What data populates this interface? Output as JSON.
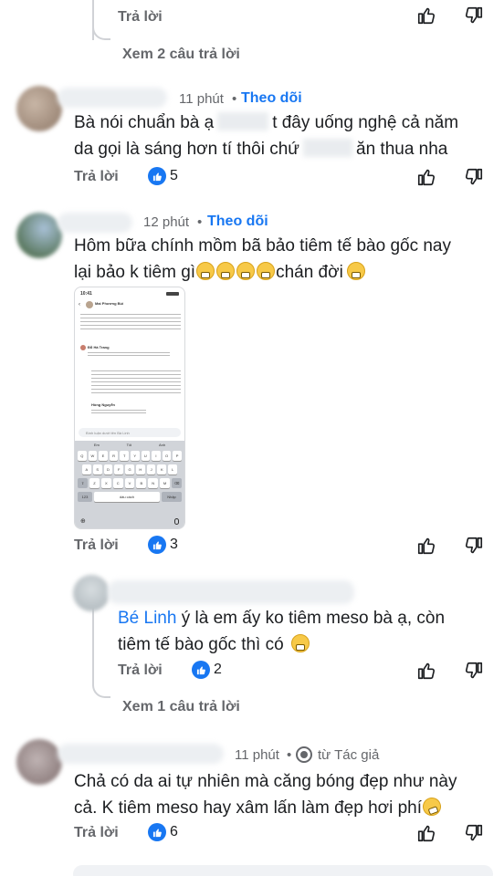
{
  "actions": {
    "reply": "Trả lời"
  },
  "top_reply": {
    "view_more": "Xem 2 câu trả lời"
  },
  "comment1": {
    "time": "11 phút",
    "separator": "•",
    "follow": "Theo dõi",
    "line1_a": "Bà nói chuẩn bà ạ",
    "line1_b": "t đây uống nghệ cả năm",
    "line2_a": "da gọi là sáng hơn tí thôi chứ",
    "line2_b": "ăn thua nha",
    "reactions": "5"
  },
  "comment2": {
    "time": "12 phút",
    "separator": "•",
    "follow": "Theo dõi",
    "line1": "Hôm bữa chính mồm bã bảo tiêm tế bào gốc nay",
    "line2_a": "lại bảo k tiêm gì",
    "line2_b": "chán đời",
    "reactions": "3"
  },
  "screenshot": {
    "time": "10:41",
    "author": "Mai Phương Bùi",
    "commenter1": "Đỗ Hà Trang",
    "commenter2": "Hồng Nguyễn",
    "input_placeholder": "Bình luận dưới tên Bà Linh",
    "suggestions": [
      "Em",
      "Tôi",
      "Anh"
    ],
    "row1": [
      "Q",
      "W",
      "E",
      "R",
      "T",
      "Y",
      "U",
      "I",
      "O",
      "P"
    ],
    "row2": [
      "A",
      "S",
      "D",
      "F",
      "G",
      "H",
      "J",
      "K",
      "L"
    ],
    "row3": [
      "Z",
      "X",
      "C",
      "V",
      "B",
      "N",
      "M"
    ],
    "space": "dấu cách",
    "enter": "Nhập",
    "num": "123"
  },
  "reply2": {
    "mention": "Bé Linh",
    "text_a": " ý là em ấy ko tiêm meso bà ạ, còn",
    "text_b": "tiêm tế bào gốc thì có",
    "reactions": "2",
    "view_more": "Xem 1 câu trả lời"
  },
  "comment3": {
    "time": "11 phút",
    "separator": "•",
    "source": "từ Tác giả",
    "line1": "Chả có da ai tự nhiên mà căng bóng đẹp như này",
    "line2": "cả. K tiêm meso hay xâm lấn làm đẹp hơi phí",
    "reactions": "6"
  },
  "colors": {
    "accent": "#1877f2",
    "muted": "#65676b"
  }
}
